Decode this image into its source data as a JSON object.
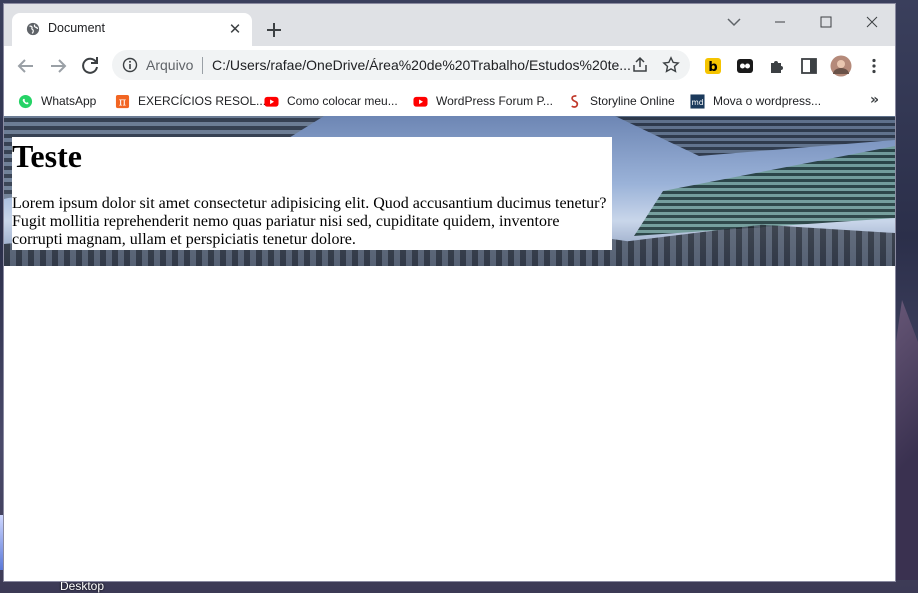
{
  "browser": {
    "tab_title": "Document",
    "address_label": "Arquivo",
    "url": "C:/Users/rafae/OneDrive/Área%20de%20Trabalho/Estudos%20te..."
  },
  "bookmarks": [
    {
      "label": "WhatsApp",
      "icon": "whatsapp-icon"
    },
    {
      "label": "EXERCÍCIOS RESOL...",
      "icon": "pi-icon"
    },
    {
      "label": "Como colocar meu...",
      "icon": "youtube-icon"
    },
    {
      "label": "WordPress Forum P...",
      "icon": "youtube-icon"
    },
    {
      "label": "Storyline Online",
      "icon": "storyline-icon"
    },
    {
      "label": "Mova o wordpress...",
      "icon": "md-icon"
    }
  ],
  "page": {
    "heading": "Teste",
    "paragraph": "Lorem ipsum dolor sit amet consectetur adipisicing elit. Quod accusantium ducimus tenetur? Fugit mollitia reprehenderit nemo quas pariatur nisi sed, cupiditate quidem, inventore corrupti magnam, ullam et perspiciatis tenetur dolore."
  },
  "desktop": {
    "icon_label": "Desktop"
  },
  "colors": {
    "titlebar": "#dfe1e5",
    "omnibox": "#f1f3f4",
    "youtube_red": "#ff0000",
    "whatsapp_green": "#25d366"
  }
}
